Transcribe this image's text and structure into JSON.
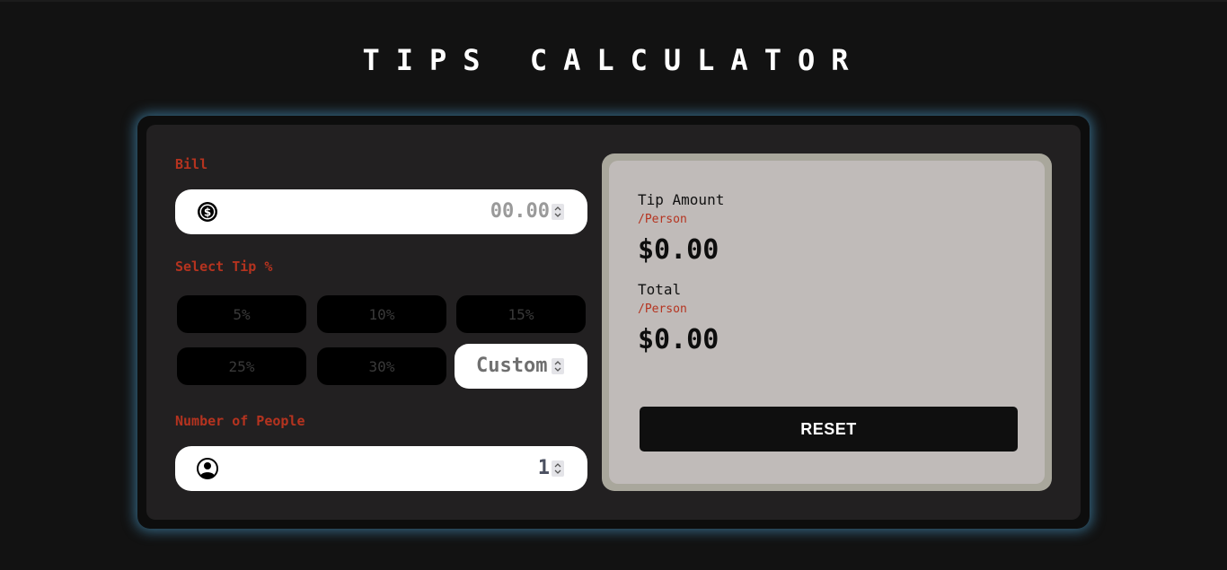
{
  "header": {
    "title": "TIPS CALCULATOR"
  },
  "form": {
    "bill_label": "Bill",
    "bill_value": "00.00",
    "tip_label": "Select Tip %",
    "tip_options": [
      "5%",
      "10%",
      "15%",
      "25%",
      "30%"
    ],
    "custom_value": "Custom",
    "people_label": "Number of People",
    "people_value": "1"
  },
  "results": {
    "tip_label": "Tip Amount",
    "tip_sub": "/Person",
    "tip_amount": "$0.00",
    "total_label": "Total",
    "total_sub": "/Person",
    "total_amount": "$0.00",
    "reset_label": "RESET"
  },
  "icons": {
    "bill": "dollar-circle-icon",
    "people": "person-circle-icon"
  },
  "colors": {
    "accent": "#b5331f",
    "glow": "#50aadc",
    "background": "#121212"
  }
}
